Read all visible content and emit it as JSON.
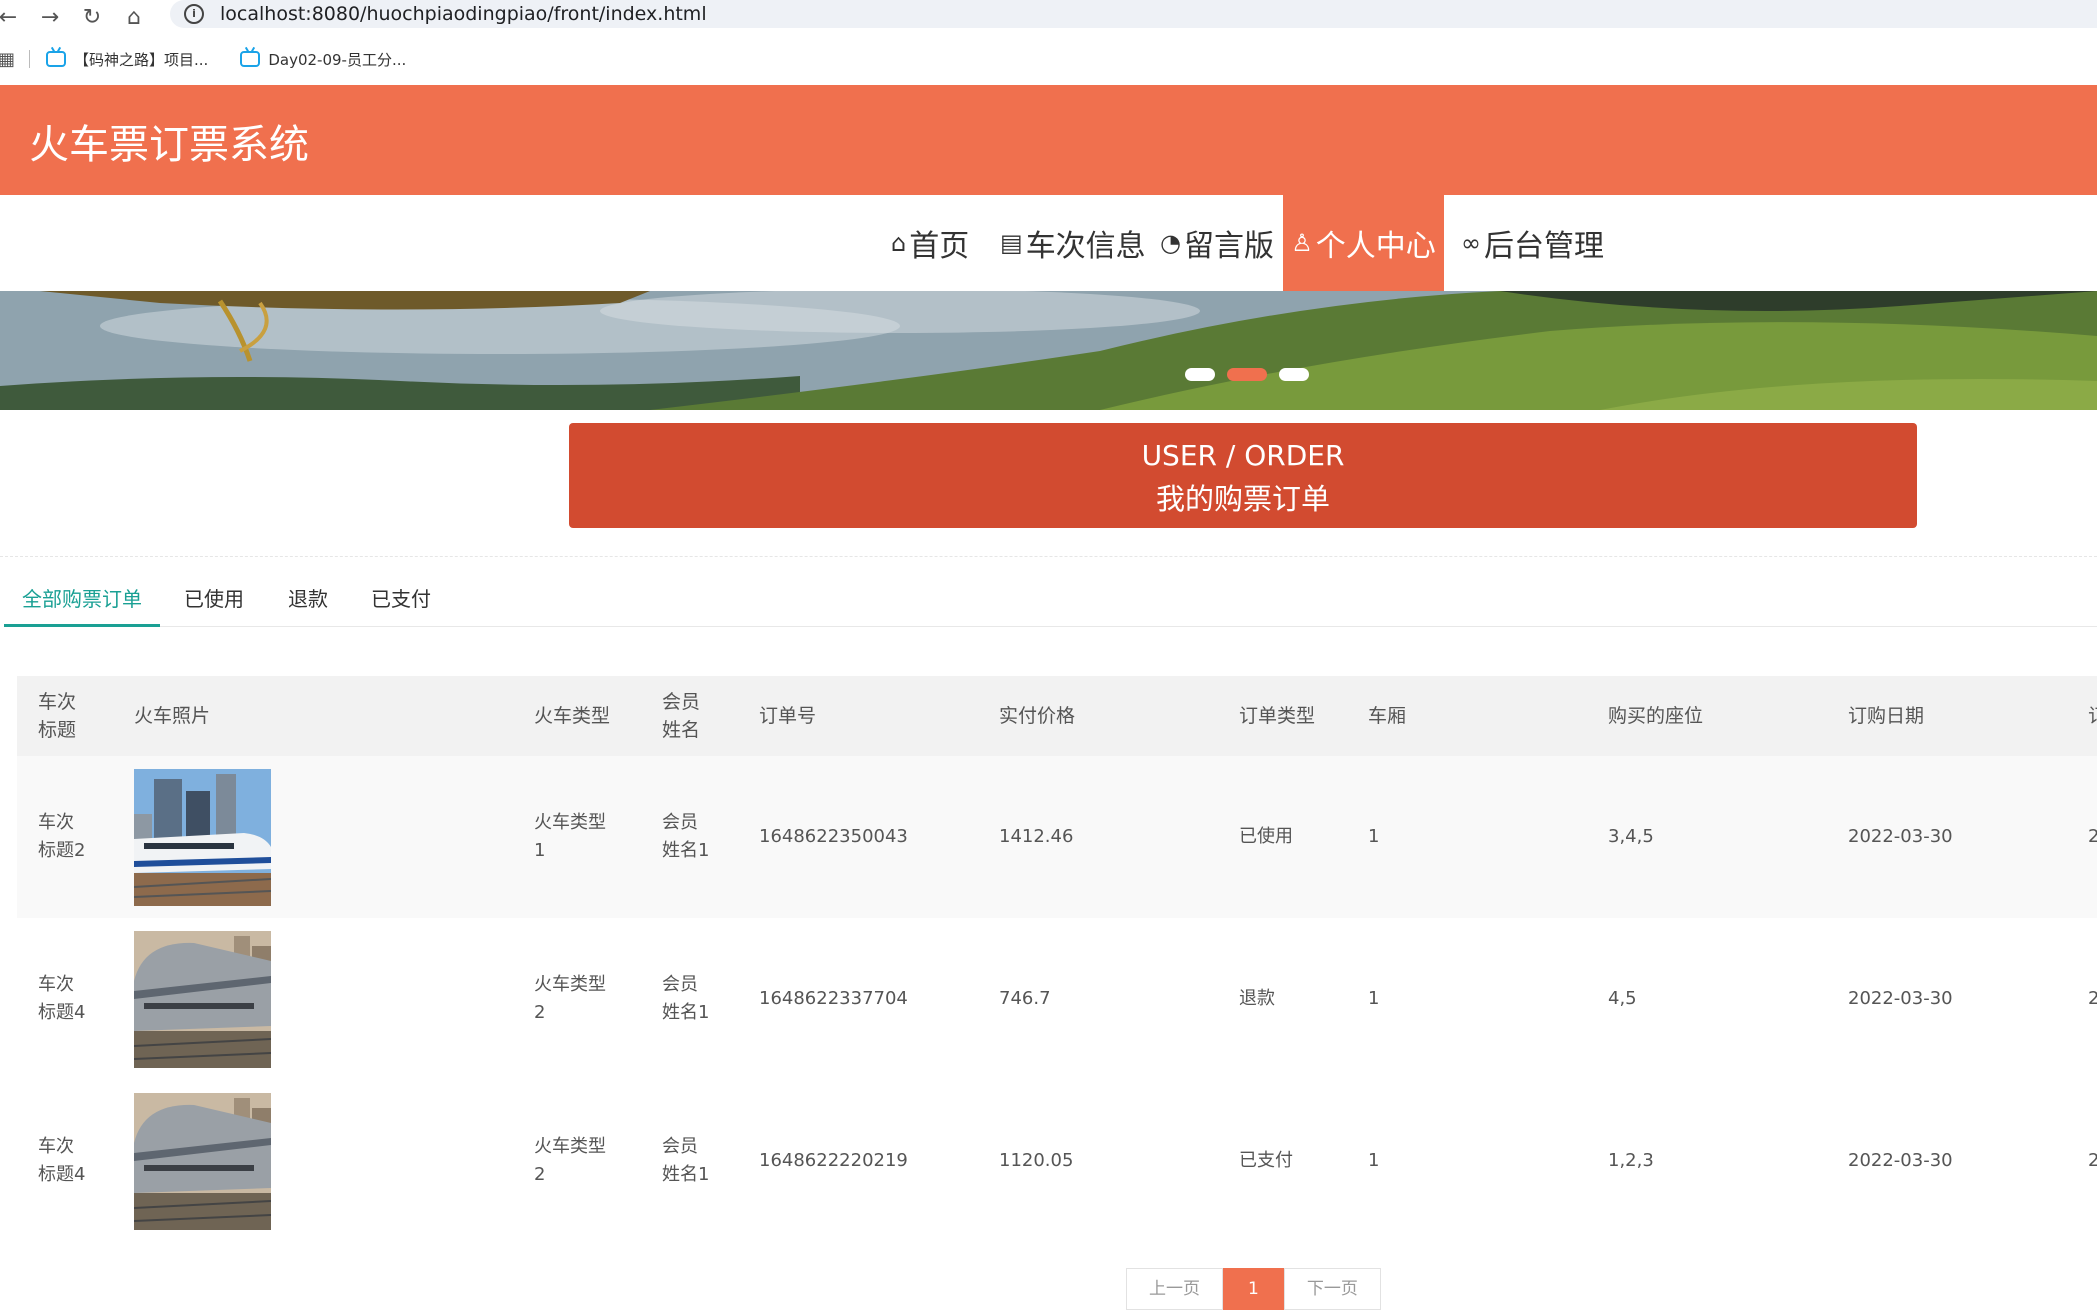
{
  "browser": {
    "url": "localhost:8080/huochpiaodingpiao/front/index.html",
    "bookmarks": [
      {
        "label": "【码神之路】项目..."
      },
      {
        "label": "Day02-09-员工分..."
      }
    ]
  },
  "site": {
    "title": "火车票订票系统",
    "nav": [
      {
        "label": "首页",
        "icon": "home-icon"
      },
      {
        "label": "车次信息",
        "icon": "clipboard-icon"
      },
      {
        "label": "留言版",
        "icon": "palette-icon"
      },
      {
        "label": "个人中心",
        "icon": "user-icon",
        "active": true
      },
      {
        "label": "后台管理",
        "icon": "link-icon"
      }
    ],
    "accent_color": "#f0704e"
  },
  "section": {
    "title_en": "USER / ORDER",
    "title_cn": "我的购票订单"
  },
  "tabs": [
    {
      "label": "全部购票订单",
      "active": true
    },
    {
      "label": "已使用"
    },
    {
      "label": "退款"
    },
    {
      "label": "已支付"
    }
  ],
  "table": {
    "headers": [
      "车次\n标题",
      "火车照片",
      "火车类型",
      "会员\n姓名",
      "订单号",
      "实付价格",
      "订单类型",
      "车厢",
      "购买的座位",
      "订购日期",
      "订"
    ],
    "rows": [
      {
        "title": "车次\n标题2",
        "type": "火车类型\n1",
        "member": "会员\n姓名1",
        "order_no": "1648622350043",
        "price": "1412.46",
        "status": "已使用",
        "carriage": "1",
        "seats": "3,4,5",
        "date": "2022-03-30",
        "extra": "2"
      },
      {
        "title": "车次\n标题4",
        "type": "火车类型\n2",
        "member": "会员\n姓名1",
        "order_no": "1648622337704",
        "price": "746.7",
        "status": "退款",
        "carriage": "1",
        "seats": "4,5",
        "date": "2022-03-30",
        "extra": "2"
      },
      {
        "title": "车次\n标题4",
        "type": "火车类型\n2",
        "member": "会员\n姓名1",
        "order_no": "1648622220219",
        "price": "1120.05",
        "status": "已支付",
        "carriage": "1",
        "seats": "1,2,3",
        "date": "2022-03-30",
        "extra": "2"
      }
    ]
  },
  "pagination": {
    "prev": "上一页",
    "current": "1",
    "next": "下一页"
  }
}
